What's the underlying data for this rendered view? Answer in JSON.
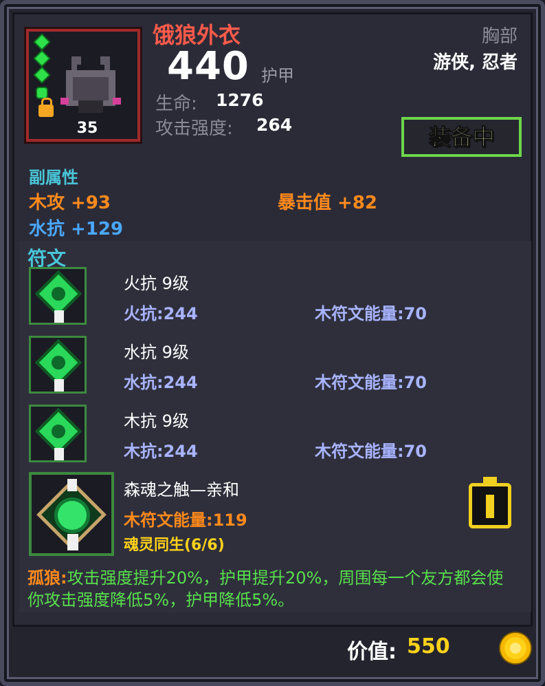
{
  "item": {
    "name": "饿狼外衣",
    "level": "35",
    "armor_value": "440",
    "armor_label": "护甲",
    "slot": "胸部",
    "classes": "游侠, 忍者",
    "stats": [
      {
        "label": "生命:",
        "value": "1276"
      },
      {
        "label": "攻击强度:",
        "value": "264"
      }
    ],
    "equip_status": "装备中"
  },
  "sub_attributes": {
    "title": "副属性",
    "entries": [
      {
        "text": "木攻 +93",
        "color": "#ff8a1c"
      },
      {
        "text": "暴击值 +82",
        "color": "#ff8a1c"
      },
      {
        "text": "水抗 +129",
        "color": "#4aa8ff"
      }
    ]
  },
  "runes": {
    "title": "符文",
    "items": [
      {
        "title": "火抗 9级",
        "stat": "火抗:244",
        "energy": "木符文能量:70",
        "icon": "fire-rune-icon"
      },
      {
        "title": "水抗 9级",
        "stat": "水抗:244",
        "energy": "木符文能量:70",
        "icon": "water-rune-icon"
      },
      {
        "title": "木抗 9级",
        "stat": "木抗:244",
        "energy": "木符文能量:70",
        "icon": "wood-rune-icon"
      }
    ],
    "set": {
      "title": "森魂之触—亲和",
      "energy": "木符文能量:119",
      "bonus": "魂灵同生(6/6)"
    }
  },
  "description": {
    "prefix": "孤狼:",
    "text": "攻击强度提升20%，护甲提升20%，周围每一个友方都会使你攻击强度降低5%，护甲降低5%。"
  },
  "price": {
    "label": "价值:",
    "value": "550"
  },
  "colors": {
    "name_red": "#ff5a4a",
    "equip_green": "#6ed64a",
    "section_cyan": "#49c6d8",
    "desc_green": "#58e04c",
    "gold": "#ffd21a"
  }
}
